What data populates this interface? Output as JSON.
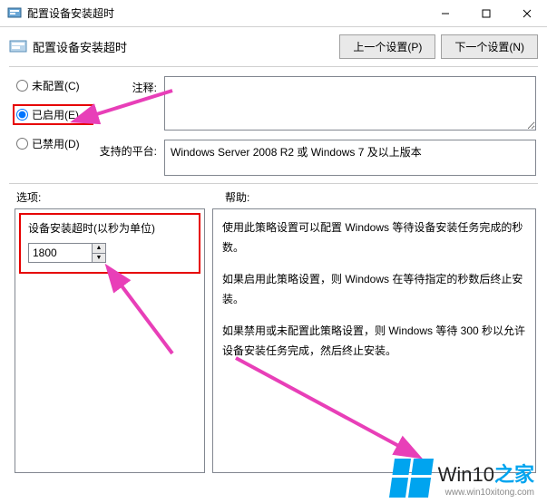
{
  "window": {
    "title": "配置设备安装超时"
  },
  "header": {
    "title": "配置设备安装超时",
    "prev_btn": "上一个设置(P)",
    "next_btn": "下一个设置(N)"
  },
  "radios": {
    "not_configured": "未配置(C)",
    "enabled": "已启用(E)",
    "disabled": "已禁用(D)",
    "selected": "enabled"
  },
  "fields": {
    "comment_label": "注释:",
    "platform_label": "支持的平台:",
    "platform_text": "Windows Server 2008 R2 或 Windows 7 及以上版本"
  },
  "labels": {
    "options": "选项:",
    "help": "帮助:"
  },
  "options": {
    "timeout_label": "设备安装超时(以秒为单位)",
    "timeout_value": "1800"
  },
  "help": {
    "p1": "使用此策略设置可以配置 Windows 等待设备安装任务完成的秒数。",
    "p2": "如果启用此策略设置，则 Windows 在等待指定的秒数后终止安装。",
    "p3": "如果禁用或未配置此策略设置，则 Windows 等待 300 秒以允许设备安装任务完成，然后终止安装。"
  },
  "watermark": {
    "brand1": "Win10",
    "brand2": "之家",
    "url": "www.win10xitong.com"
  }
}
